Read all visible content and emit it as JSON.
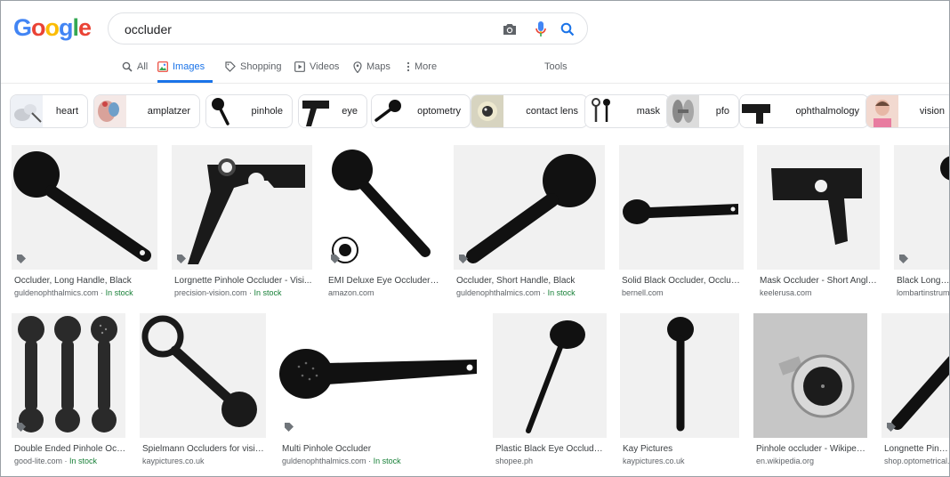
{
  "logo": "Google",
  "search": {
    "query": "occluder"
  },
  "tabs": [
    {
      "label": "All"
    },
    {
      "label": "Images"
    },
    {
      "label": "Shopping"
    },
    {
      "label": "Videos"
    },
    {
      "label": "Maps"
    },
    {
      "label": "More"
    }
  ],
  "tools_label": "Tools",
  "chips": [
    {
      "label": "heart"
    },
    {
      "label": "amplatzer"
    },
    {
      "label": "pinhole"
    },
    {
      "label": "eye"
    },
    {
      "label": "optometry"
    },
    {
      "label": "contact lens"
    },
    {
      "label": "mask"
    },
    {
      "label": "pfo"
    },
    {
      "label": "ophthalmology"
    },
    {
      "label": "vision"
    }
  ],
  "row1": [
    {
      "caption": "Occluder, Long Handle, Black",
      "source": "guldenophthalmics.com",
      "stock": "In stock"
    },
    {
      "caption": "Lorgnette Pinhole Occluder - Visi...",
      "source": "precision-vision.com",
      "stock": "In stock"
    },
    {
      "caption": "EMI Deluxe Eye Occluder f...",
      "source": "amazon.com",
      "stock": ""
    },
    {
      "caption": "Occluder, Short Handle, Black",
      "source": "guldenophthalmics.com",
      "stock": "In stock"
    },
    {
      "caption": "Solid Black Occluder, Occlud...",
      "source": "bernell.com",
      "stock": ""
    },
    {
      "caption": "Mask Occluder - Short Angle...",
      "source": "keelerusa.com",
      "stock": ""
    },
    {
      "caption": "Black Long Ha...",
      "source": "lombartinstrum...",
      "stock": ""
    }
  ],
  "row2": [
    {
      "caption": "Double Ended Pinhole Occl...",
      "source": "good-lite.com",
      "stock": "In stock"
    },
    {
      "caption": "Spielmann Occluders for visio...",
      "source": "kaypictures.co.uk",
      "stock": ""
    },
    {
      "caption": "Multi Pinhole Occluder",
      "source": "guldenophthalmics.com",
      "stock": "In stock"
    },
    {
      "caption": "Plastic Black Eye Occluder...",
      "source": "shopee.ph",
      "stock": ""
    },
    {
      "caption": "Kay Pictures",
      "source": "kaypictures.co.uk",
      "stock": ""
    },
    {
      "caption": "Pinhole occluder - Wikipedia",
      "source": "en.wikipedia.org",
      "stock": ""
    },
    {
      "caption": "Longnette Pinhol...",
      "source": "shop.optometrical...",
      "stock": ""
    }
  ],
  "stock_separator": " · ",
  "colors": {
    "accent": "#1a73e8",
    "stock": "#188038"
  }
}
